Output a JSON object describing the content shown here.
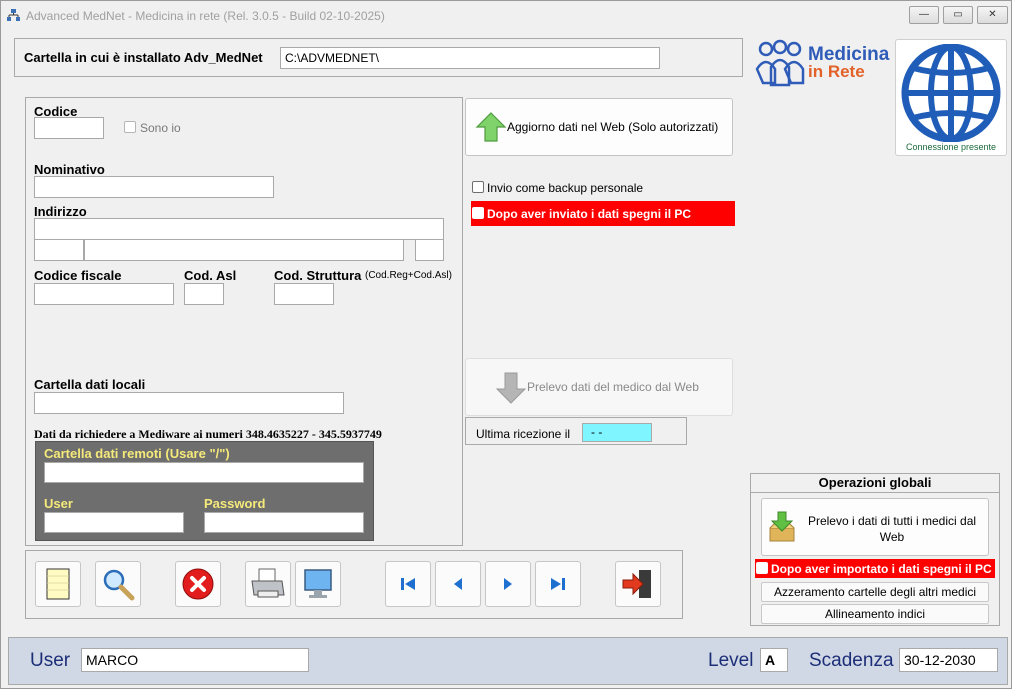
{
  "window": {
    "title": "Advanced MedNet - Medicina in rete  (Rel. 3.0.5 - Build 02-10-2025)",
    "controls": {
      "minimize": "—",
      "restore": "▭",
      "close": "✕"
    }
  },
  "install": {
    "label": "Cartella in cui è installato Adv_MedNet",
    "value": "C:\\ADVMEDNET\\"
  },
  "logo": {
    "line1": "Medicina",
    "line2": "in Rete"
  },
  "connection": {
    "status": "Connessione presente"
  },
  "form": {
    "codice_label": "Codice",
    "codice_value": "",
    "sono_io_label": "Sono io",
    "nominativo_label": "Nominativo",
    "nominativo_value": "",
    "indirizzo_label": "Indirizzo",
    "codice_fiscale_label": "Codice fiscale",
    "cod_asl_label": "Cod. Asl",
    "cod_struttura_label": "Cod. Struttura",
    "cod_struttura_hint": "(Cod.Reg+Cod.Asl)",
    "cartella_locali_label": "Cartella dati locali",
    "richiesta_text": "Dati da richiedere a  Mediware ai numeri 348.4635227 - 345.5937749",
    "remoti": {
      "cartella_label": "Cartella dati remoti  (Usare \"/\")",
      "user_label": "User",
      "password_label": "Password"
    }
  },
  "web": {
    "aggiorno_label": "Aggiorno dati nel Web  (Solo autorizzati)",
    "backup_label": "Invio come backup personale",
    "spegni_label": "Dopo aver inviato i dati spegni il PC",
    "prelevo_label": "Prelevo dati del medico dal Web",
    "ultima_label": "Ultima ricezione il",
    "ultima_value": "- -"
  },
  "globali": {
    "title": "Operazioni globali",
    "prelevo_tutti_label": "Prelevo i dati di tutti i medici dal Web",
    "spegni_label": "Dopo aver importato i dati spegni il PC",
    "azzeramento_label": "Azzeramento cartelle degli altri medici",
    "allineamento_label": "Allineamento indici"
  },
  "toolbar": {
    "icons": [
      "new-document-icon",
      "search-icon",
      "delete-icon",
      "print-icon",
      "monitor-icon",
      "first-record-icon",
      "previous-record-icon",
      "next-record-icon",
      "last-record-icon",
      "exit-icon"
    ]
  },
  "statusbar": {
    "user_label": "User",
    "user_value": "MARCO",
    "level_label": "Level",
    "level_value": "A",
    "scadenza_label": "Scadenza",
    "scadenza_value": "30-12-2030"
  },
  "colors": {
    "accent_red": "#ff0000",
    "status_bg": "#cfd8e4",
    "remote_panel": "#6e6e6e",
    "remote_label": "#f5e97a",
    "ultima_field": "#7ff5ff"
  }
}
